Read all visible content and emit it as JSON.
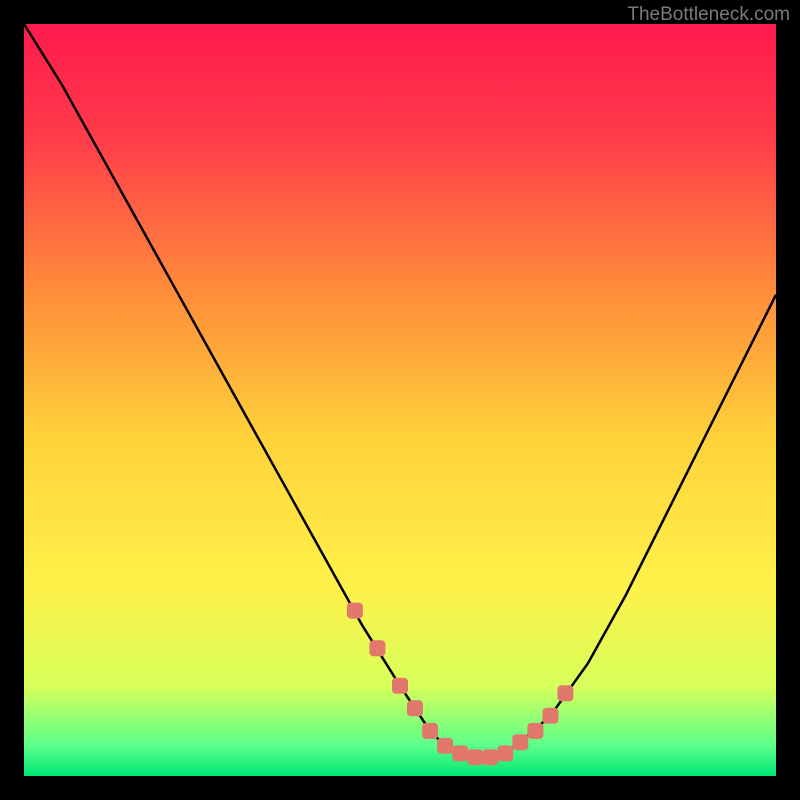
{
  "watermark": "TheBottleneck.com",
  "chart_data": {
    "type": "line",
    "title": "",
    "xlabel": "",
    "ylabel": "",
    "xlim": [
      0,
      100
    ],
    "ylim": [
      0,
      100
    ],
    "series": [
      {
        "name": "curve",
        "x": [
          0,
          5,
          10,
          15,
          20,
          25,
          30,
          35,
          40,
          45,
          50,
          52,
          54,
          56,
          58,
          60,
          62,
          64,
          66,
          70,
          75,
          80,
          85,
          90,
          95,
          100
        ],
        "y": [
          100,
          92,
          83,
          74,
          65,
          56,
          47,
          38,
          29,
          20,
          12,
          9,
          6,
          4,
          3,
          2.5,
          2.5,
          3,
          4.5,
          8,
          15,
          24,
          34,
          44,
          54,
          64
        ]
      }
    ],
    "markers": {
      "name": "highlighted-range",
      "x": [
        44,
        47,
        50,
        52,
        54,
        56,
        58,
        60,
        62,
        64,
        66,
        68,
        70,
        72
      ],
      "y": [
        22,
        17,
        12,
        9,
        6,
        4,
        3,
        2.5,
        2.5,
        3,
        4.5,
        6,
        8,
        11
      ]
    },
    "gradient_stops": [
      {
        "offset": 0,
        "color": "#ff1a4d"
      },
      {
        "offset": 15,
        "color": "#ff3b4a"
      },
      {
        "offset": 35,
        "color": "#ff8a3a"
      },
      {
        "offset": 55,
        "color": "#ffd23a"
      },
      {
        "offset": 75,
        "color": "#fff14a"
      },
      {
        "offset": 88,
        "color": "#d8ff5a"
      },
      {
        "offset": 96,
        "color": "#5aff8a"
      },
      {
        "offset": 100,
        "color": "#00e676"
      }
    ]
  }
}
